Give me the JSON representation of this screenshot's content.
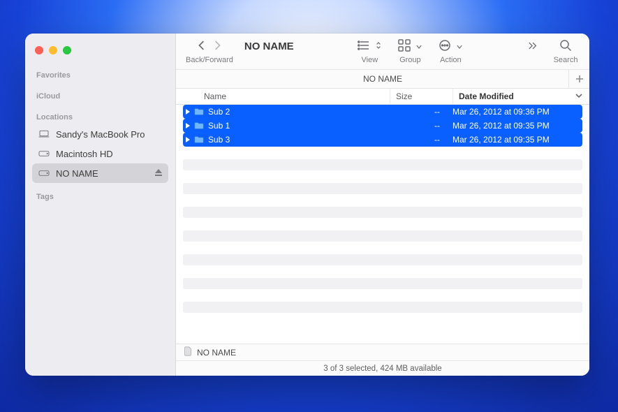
{
  "window_title": "NO NAME",
  "traffic": {
    "close": "close",
    "minimize": "minimize",
    "zoom": "zoom"
  },
  "sidebar": {
    "headings": {
      "favorites": "Favorites",
      "icloud": "iCloud",
      "locations": "Locations",
      "tags": "Tags"
    },
    "locations": [
      {
        "label": "Sandy's MacBook Pro",
        "icon": "laptop-icon",
        "ejectable": false,
        "selected": false
      },
      {
        "label": "Macintosh HD",
        "icon": "disk-icon",
        "ejectable": false,
        "selected": false
      },
      {
        "label": "NO NAME",
        "icon": "disk-icon",
        "ejectable": true,
        "selected": true
      }
    ]
  },
  "toolbar": {
    "back_forward_label": "Back/Forward",
    "view_label": "View",
    "group_label": "Group",
    "action_label": "Action",
    "search_label": "Search"
  },
  "location_bar": {
    "title": "NO NAME"
  },
  "columns": {
    "name": "Name",
    "size": "Size",
    "date": "Date Modified"
  },
  "rows": [
    {
      "name": "Sub 2",
      "size": "--",
      "date": "Mar 26, 2012 at 09:36 PM",
      "selected": true
    },
    {
      "name": "Sub 1",
      "size": "--",
      "date": "Mar 26, 2012 at 09:35 PM",
      "selected": true
    },
    {
      "name": "Sub 3",
      "size": "--",
      "date": "Mar 26, 2012 at 09:35 PM",
      "selected": true
    }
  ],
  "path_bar": {
    "label": "NO NAME"
  },
  "status": "3 of 3 selected, 424 MB available"
}
